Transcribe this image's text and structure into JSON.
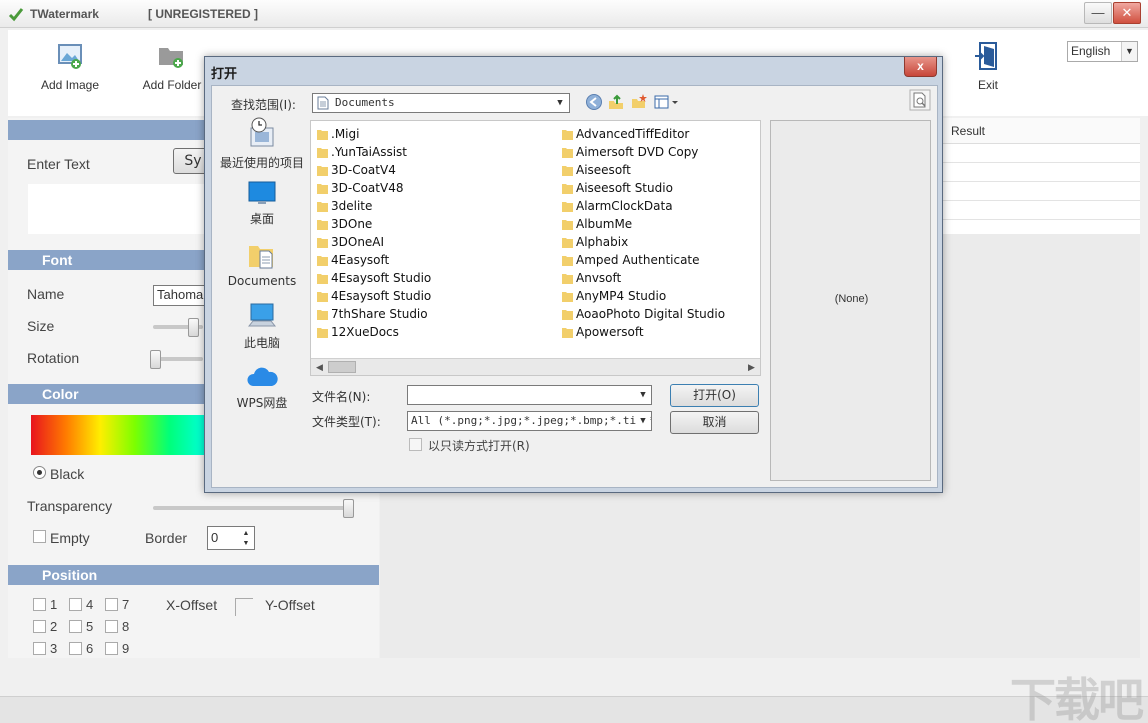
{
  "window": {
    "title": "TWatermark",
    "registration": "[ UNREGISTERED ]",
    "minimize": "—",
    "close": "✕"
  },
  "toolbar": {
    "add_image": "Add Image",
    "add_folder": "Add Folder",
    "exit": "Exit",
    "language": "English"
  },
  "left": {
    "enter_text_label": "Enter Text",
    "symbol_button": "Sy",
    "font_section": "Font",
    "name_label": "Name",
    "font_name": "Tahoma",
    "size_label": "Size",
    "rotation_label": "Rotation",
    "color_section": "Color",
    "black_label": "Black",
    "transparency_label": "Transparency",
    "empty_label": "Empty",
    "border_label": "Border",
    "border_value": "0",
    "position_section": "Position",
    "positions": [
      "1",
      "2",
      "3",
      "4",
      "5",
      "6",
      "7",
      "8",
      "9"
    ],
    "x_offset_label": "X-Offset",
    "y_offset_label": "Y-Offset",
    "size_level": 0.3,
    "rotation_level": 0.0,
    "transparency_level": 1.0
  },
  "right": {
    "result_header": "Result"
  },
  "dialog": {
    "title": "打开",
    "close": "x",
    "look_in_label": "查找范围(I):",
    "look_in_value": "Documents",
    "places": [
      {
        "label": "最近使用的项目",
        "icon": "recent-items-icon"
      },
      {
        "label": "桌面",
        "icon": "desktop-icon"
      },
      {
        "label": "Documents",
        "icon": "documents-icon"
      },
      {
        "label": "此电脑",
        "icon": "this-pc-icon"
      },
      {
        "label": "WPS网盘",
        "icon": "wps-cloud-icon"
      }
    ],
    "files_col1": [
      ".Migi",
      ".YunTaiAssist",
      "3D-CoatV4",
      "3D-CoatV48",
      "3delite",
      "3DOne",
      "3DOneAI",
      "4Easysoft",
      "4Esaysoft Studio",
      "4Esaysoft Studio",
      "7thShare Studio",
      "12XueDocs"
    ],
    "files_col2": [
      "AdvancedTiffEditor",
      "Aimersoft DVD Copy",
      "Aiseesoft",
      "Aiseesoft Studio",
      "AlarmClockData",
      "AlbumMe",
      "Alphabix",
      "Amped Authenticate",
      "Anvsoft",
      "AnyMP4 Studio",
      "AoaoPhoto Digital Studio",
      "Apowersoft"
    ],
    "preview": "(None)",
    "file_name_label": "文件名(N):",
    "file_name_value": "",
    "file_type_label": "文件类型(T):",
    "file_type_value": "All (*.png;*.jpg;*.jpeg;*.bmp;*.tif;*",
    "open_button": "打开(O)",
    "cancel_button": "取消",
    "readonly_label": "以只读方式打开(R)"
  },
  "watermark": "下载吧",
  "colors": {
    "section_bar": "#8aa4c8",
    "dialog_frame": "#c9d4e2",
    "folder": "#f2cf6b"
  }
}
